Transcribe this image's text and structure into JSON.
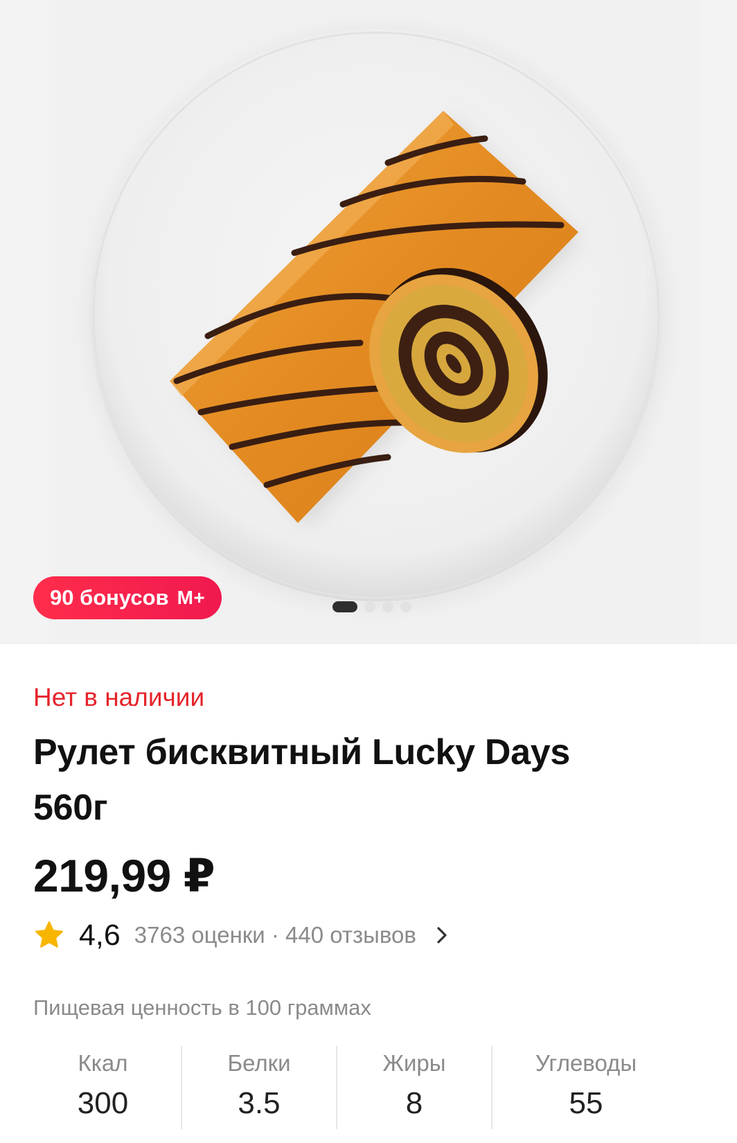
{
  "product": {
    "bonus_amount": "90 бонусов",
    "bonus_brand": "M+",
    "carousel_total": 4,
    "carousel_active": 1,
    "stock_status": "Нет в наличии",
    "title_line1": "Рулет бисквитный Lucky Days",
    "title_line2": "560г",
    "price": "219,99 ₽",
    "rating": {
      "value": "4,6",
      "meta": "3763 оценки · 440 отзывов"
    }
  },
  "nutrition": {
    "title": "Пищевая ценность в 100 граммах",
    "items": [
      {
        "label": "Ккал",
        "value": "300"
      },
      {
        "label": "Белки",
        "value": "3.5"
      },
      {
        "label": "Жиры",
        "value": "8"
      },
      {
        "label": "Углеводы",
        "value": "55"
      }
    ]
  },
  "colors": {
    "accent_red": "#e5242b",
    "bonus_gradient_start": "#ff2d4b",
    "bonus_gradient_end": "#f0194f",
    "star": "#f7b500"
  },
  "icons": [
    "star-icon",
    "chevron-right-icon"
  ]
}
